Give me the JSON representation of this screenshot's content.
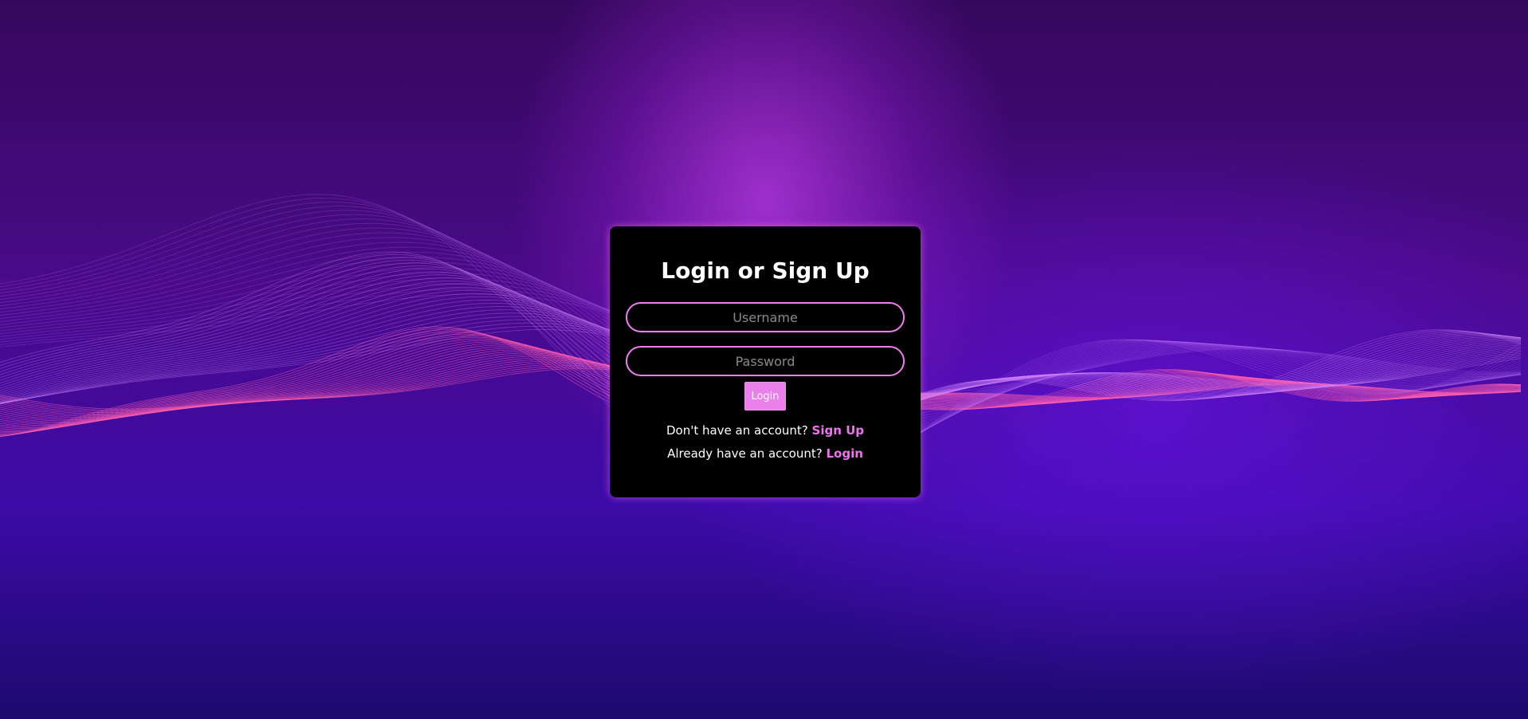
{
  "login_card": {
    "title": "Login or Sign Up",
    "username_placeholder": "Username",
    "password_placeholder": "Password",
    "login_button_label": "Login",
    "signup_prompt": "Don't have an account? ",
    "signup_link": "Sign Up",
    "login_prompt": "Already have an account? ",
    "login_link": "Login"
  },
  "colors": {
    "accent": "#ee74ee",
    "card_background": "#000000",
    "page_background": "#4a0a8a"
  }
}
